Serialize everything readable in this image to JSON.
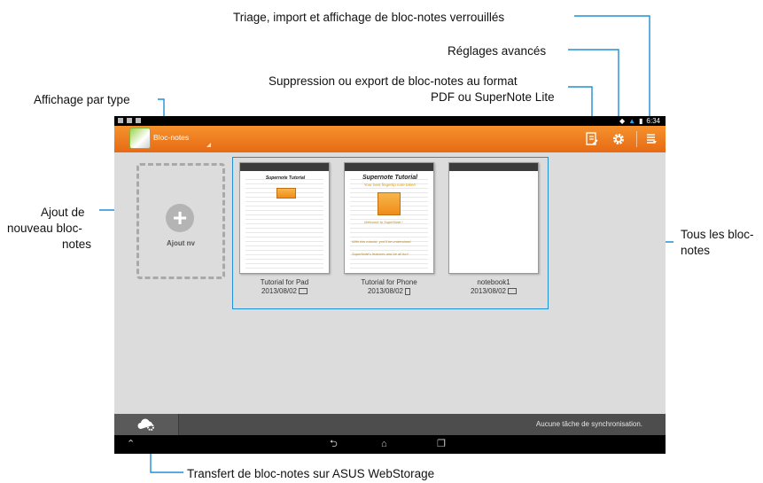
{
  "callouts": {
    "sort": "Triage, import et affichage de bloc-notes verrouillés",
    "settings": "Réglages avancés",
    "delete_export_line1": "Suppression ou export de bloc-notes au format",
    "delete_export_line2": "PDF ou SuperNote Lite",
    "view_by_type": "Affichage par type",
    "add_line1": "Ajout de",
    "add_line2": "nouveau bloc-",
    "add_line3": "notes",
    "all_line1": "Tous les bloc-",
    "all_line2": "notes",
    "transfer": "Transfert de bloc-notes sur ASUS WebStorage"
  },
  "statusbar": {
    "time": "6:34"
  },
  "actionbar": {
    "title": "Bloc-notes",
    "icons": [
      "export-icon",
      "gear-icon",
      "menu-icon"
    ]
  },
  "add_tile": {
    "label": "Ajout nv",
    "icon": "plus-icon"
  },
  "notebooks": [
    {
      "name": "Tutorial for Pad",
      "date": "2013/08/02",
      "device": "tablet-icon",
      "page_title": "Supernote Tutorial"
    },
    {
      "name": "Tutorial for Phone",
      "date": "2013/08/02",
      "device": "phone-icon",
      "page_title": "Supernote Tutorial",
      "page_sub": "Your best fingertip note taker!",
      "script1": "Welcome to SuperNote !",
      "script2": "With this tutorial, you'll be understand",
      "script3": "SuperNote's features and be all fun!"
    },
    {
      "name": "notebook1",
      "date": "2013/08/02",
      "device": "tablet-icon"
    }
  ],
  "syncbar": {
    "status": "Aucune tâche de synchronisation.",
    "icon": "cloud-gear-icon"
  },
  "navbar": {
    "icons": [
      "back-icon",
      "home-icon",
      "recent-apps-icon"
    ]
  },
  "colors": {
    "accent": "#1f8fd6",
    "actionbar": "#f08a25"
  }
}
